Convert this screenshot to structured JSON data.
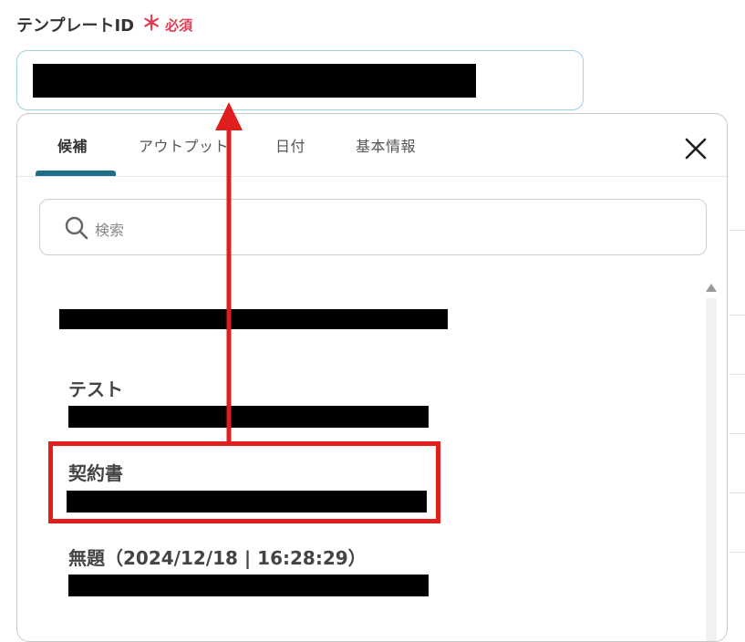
{
  "field": {
    "label": "テンプレートID",
    "required_mark": "＊",
    "required_text": "必須"
  },
  "popover": {
    "tabs": [
      {
        "label": "候補",
        "active": true
      },
      {
        "label": "アウトプット",
        "active": false
      },
      {
        "label": "日付",
        "active": false
      },
      {
        "label": "基本情報",
        "active": false
      }
    ],
    "search": {
      "placeholder": "検索"
    },
    "items": [
      {
        "title": ""
      },
      {
        "title": "テスト"
      },
      {
        "title": "契約書"
      },
      {
        "title": "無題（2024/12/18 | 16:28:29）"
      }
    ]
  },
  "colors": {
    "accent": "#1d6f88",
    "required": "#e23b53",
    "annotation": "#e11e1e",
    "input_border": "#9fd0e6"
  },
  "icons": {
    "search": "search-icon",
    "close": "close-icon"
  }
}
